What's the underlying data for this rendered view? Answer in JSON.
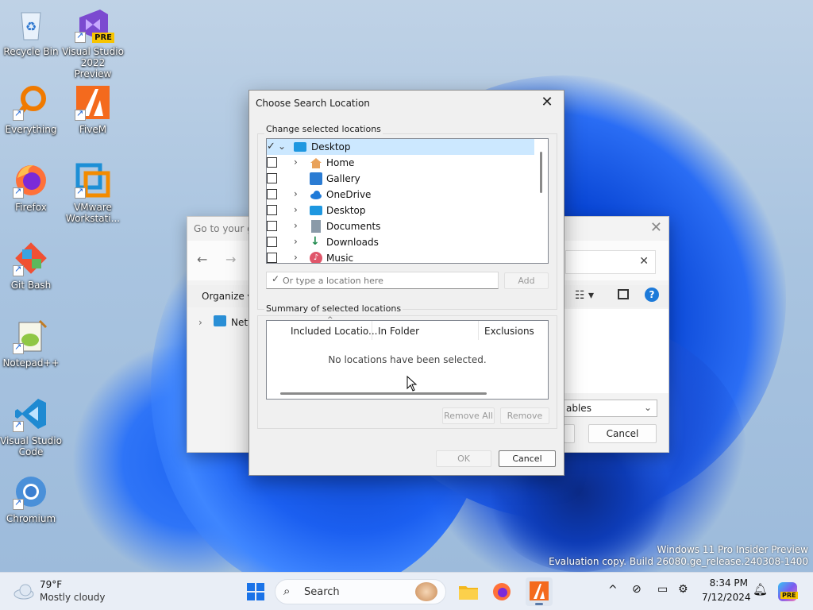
{
  "desktop": {
    "icons": [
      {
        "label": "Recycle Bin"
      },
      {
        "label": "Visual Studio 2022 Preview",
        "badge": "PRE"
      },
      {
        "label": "Everything"
      },
      {
        "label": "FiveM"
      },
      {
        "label": "Firefox"
      },
      {
        "label": "VMware Workstati..."
      },
      {
        "label": "Git Bash"
      },
      {
        "label": "Notepad++"
      },
      {
        "label": "Visual Studio Code"
      },
      {
        "label": "Chromium"
      }
    ],
    "watermark": {
      "line1": "Windows 11 Pro Insider Preview",
      "line2": "Evaluation copy. Build 26080.ge_release.240308-1400"
    }
  },
  "bg_dialog": {
    "address_text": "Go to your g",
    "organize_label": "Organize",
    "tree_item": "Netw",
    "filter_text": "ables",
    "cancel_label": "Cancel"
  },
  "dialog": {
    "title": "Choose Search Location",
    "change_group_label": "Change selected locations",
    "tree": [
      {
        "label": "Desktop",
        "checkbox": "check",
        "expanded": true,
        "selected": true
      },
      {
        "label": "Home",
        "checkbox": "unchecked",
        "expandable": true
      },
      {
        "label": "Gallery",
        "checkbox": "unchecked",
        "expandable": false
      },
      {
        "label": "OneDrive",
        "checkbox": "unchecked",
        "expandable": true
      },
      {
        "label": "Desktop",
        "checkbox": "unchecked",
        "expandable": true
      },
      {
        "label": "Documents",
        "checkbox": "unchecked",
        "expandable": true
      },
      {
        "label": "Downloads",
        "checkbox": "unchecked",
        "expandable": true
      },
      {
        "label": "Music",
        "checkbox": "unchecked",
        "expandable": true
      }
    ],
    "location_input": {
      "placeholder": "Or type a location here",
      "value": ""
    },
    "add_label": "Add",
    "summary_group_label": "Summary of selected locations",
    "columns": [
      "Included Locatio...",
      "In Folder",
      "Exclusions"
    ],
    "empty_message": "No locations have been selected.",
    "remove_all_label": "Remove All",
    "remove_label": "Remove",
    "ok_label": "OK",
    "cancel_label": "Cancel"
  },
  "taskbar": {
    "weather": {
      "temp": "79°F",
      "condition": "Mostly cloudy"
    },
    "search_label": "Search",
    "clock": {
      "time": "8:34 PM",
      "date": "7/12/2024"
    },
    "copilot_badge": "PRE"
  },
  "colors": {
    "accent": "#0067c0",
    "selection": "#cce8ff",
    "dialog_bg": "#f0f0f0",
    "taskbar_bg": "#e9eef6"
  }
}
